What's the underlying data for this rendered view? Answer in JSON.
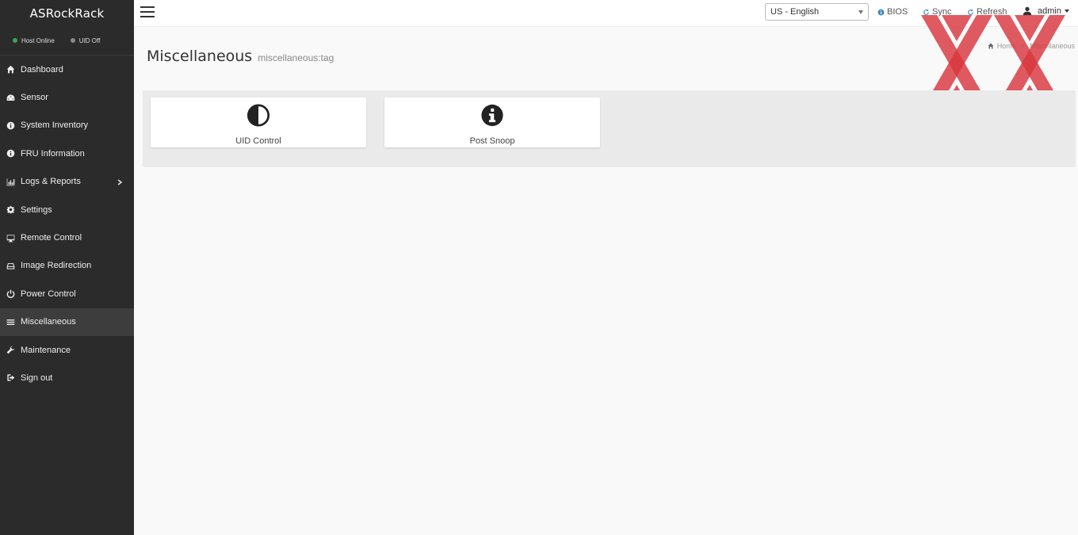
{
  "brand": "ASRockRack",
  "status": {
    "host": "Host Online",
    "uid": "UID Off",
    "colors": {
      "host": "#3aa85a",
      "uid": "#8a8a8a"
    }
  },
  "sidebar": {
    "items": [
      {
        "label": "Dashboard",
        "icon": "home-icon"
      },
      {
        "label": "Sensor",
        "icon": "dashboard-gauge-icon"
      },
      {
        "label": "System Inventory",
        "icon": "info-circle-icon"
      },
      {
        "label": "FRU Information",
        "icon": "info-circle-icon"
      },
      {
        "label": "Logs & Reports",
        "icon": "bar-chart-icon",
        "has_submenu": true
      },
      {
        "label": "Settings",
        "icon": "gear-icon"
      },
      {
        "label": "Remote Control",
        "icon": "monitor-icon"
      },
      {
        "label": "Image Redirection",
        "icon": "drive-icon"
      },
      {
        "label": "Power Control",
        "icon": "power-icon"
      },
      {
        "label": "Miscellaneous",
        "icon": "list-icon",
        "active": true
      },
      {
        "label": "Maintenance",
        "icon": "wrench-icon"
      },
      {
        "label": "Sign out",
        "icon": "sign-out-icon"
      }
    ]
  },
  "topbar": {
    "language": "US - English",
    "bios": "BIOS",
    "sync": "Sync",
    "refresh": "Refresh",
    "user": "admin"
  },
  "header": {
    "title": "Miscellaneous",
    "subtitle": "miscellaneous:tag"
  },
  "breadcrumb": {
    "home": "Home",
    "current": "Miscellaneous"
  },
  "tiles": [
    {
      "label": "UID Control",
      "icon": "contrast-half-circle-icon"
    },
    {
      "label": "Post Snoop",
      "icon": "info-circle-icon"
    }
  ],
  "colors": {
    "sidebar_bg": "#2b2b2b",
    "accent_blue": "#3c8dbc",
    "watermark_red": "#d9363e"
  }
}
